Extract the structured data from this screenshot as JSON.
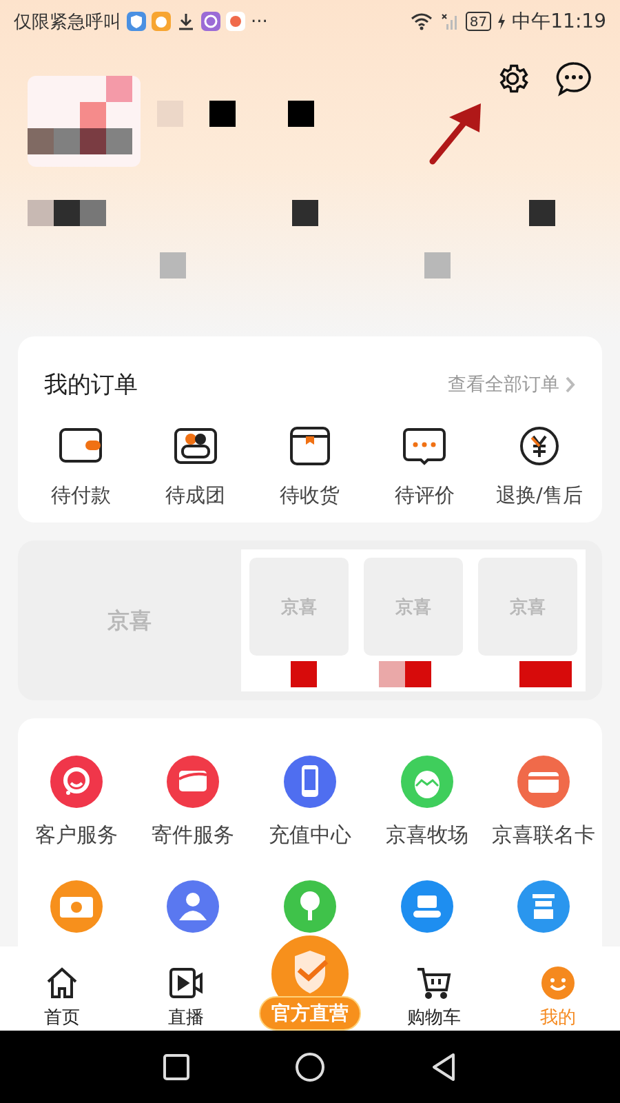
{
  "status_bar": {
    "notice": "仅限紧急呼叫",
    "more": "···",
    "battery": "87",
    "time": "中午11:19"
  },
  "order_card": {
    "title": "我的订单",
    "link": "查看全部订单",
    "items": [
      {
        "label": "待付款",
        "kind": "wallet"
      },
      {
        "label": "待成团",
        "kind": "group"
      },
      {
        "label": "待收货",
        "kind": "box"
      },
      {
        "label": "待评价",
        "kind": "chat"
      },
      {
        "label": "退换/售后",
        "kind": "refund"
      }
    ]
  },
  "promo": {
    "brand": "京喜",
    "products": [
      {
        "brand": "京喜"
      },
      {
        "brand": "京喜"
      },
      {
        "brand": "京喜"
      }
    ]
  },
  "services": [
    {
      "label": "客户服务",
      "kind": "headset",
      "color": "#f0364a"
    },
    {
      "label": "寄件服务",
      "kind": "envelope",
      "color": "#f03a48"
    },
    {
      "label": "充值中心",
      "kind": "phone",
      "color": "#4f6ef0"
    },
    {
      "label": "京喜牧场",
      "kind": "egg",
      "color": "#3fce5c"
    },
    {
      "label": "京喜联名卡",
      "kind": "card",
      "color": "#f06a4a"
    },
    {
      "kind": "coupon",
      "color": "#f7901c"
    },
    {
      "kind": "person",
      "color": "#5a78f0"
    },
    {
      "kind": "tree",
      "color": "#3fc24a"
    },
    {
      "kind": "robot",
      "color": "#1e8ef0"
    },
    {
      "kind": "rich",
      "color": "#2a96ee"
    }
  ],
  "tab_bar": [
    {
      "label": "首页",
      "kind": "home",
      "selected": false
    },
    {
      "label": "直播",
      "kind": "video",
      "selected": false
    },
    {
      "label": "官方直营",
      "kind": "featured",
      "selected": false
    },
    {
      "label": "购物车",
      "kind": "cart",
      "selected": false
    },
    {
      "label": "我的",
      "kind": "face",
      "selected": true
    }
  ]
}
